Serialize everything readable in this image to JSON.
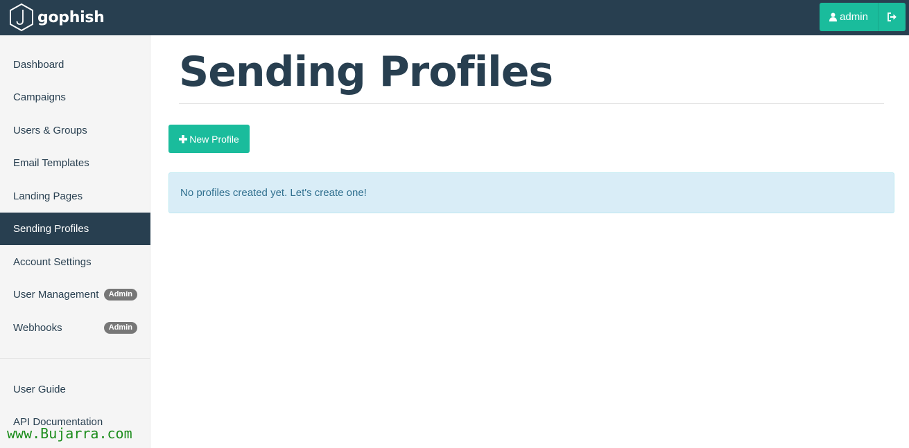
{
  "header": {
    "brand": "gophish",
    "user_label": "admin"
  },
  "sidebar": {
    "items": [
      {
        "label": "Dashboard"
      },
      {
        "label": "Campaigns"
      },
      {
        "label": "Users & Groups"
      },
      {
        "label": "Email Templates"
      },
      {
        "label": "Landing Pages"
      },
      {
        "label": "Sending Profiles",
        "active": true
      },
      {
        "label": "Account Settings"
      },
      {
        "label": "User Management",
        "badge": "Admin"
      },
      {
        "label": "Webhooks",
        "badge": "Admin"
      }
    ],
    "bottom_items": [
      {
        "label": "User Guide"
      },
      {
        "label": "API Documentation"
      }
    ]
  },
  "main": {
    "title": "Sending Profiles",
    "new_button_label": "New Profile",
    "empty_message": "No profiles created yet. Let's create one!"
  },
  "watermark": "www.Bujarra.com",
  "colors": {
    "header_bg": "#283f50",
    "accent": "#1abc9c",
    "active_nav": "#283f50",
    "alert_bg": "#d9edf7",
    "alert_text": "#31708f"
  }
}
